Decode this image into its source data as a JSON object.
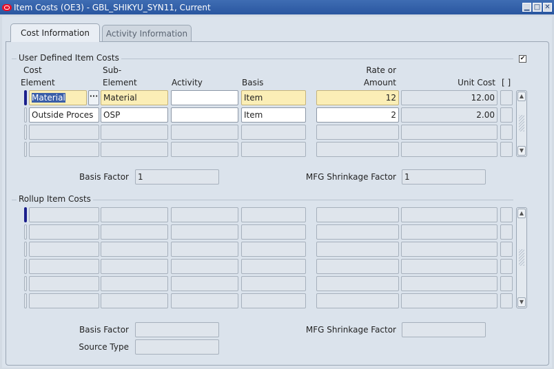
{
  "window": {
    "title": "Item Costs (OE3) - GBL_SHIKYU_SYN11, Current"
  },
  "tabs": [
    {
      "label": "Cost Information",
      "active": true
    },
    {
      "label": "Activity Information",
      "active": false
    }
  ],
  "user_defined": {
    "section_label": "User Defined Item Costs",
    "headers": {
      "cost_element_1": "Cost",
      "cost_element_2": "Element",
      "sub_element_1": "Sub-",
      "sub_element_2": "Element",
      "activity": "Activity",
      "basis": "Basis",
      "rate_1": "Rate or",
      "rate_2": "Amount",
      "unit_cost": "Unit Cost",
      "flag": "[ ]"
    },
    "rows": [
      {
        "cost_element": "Material",
        "sub_element": "Material",
        "activity": "",
        "basis": "Item",
        "rate": "12",
        "unit_cost": "12.00"
      },
      {
        "cost_element": "Outside Proces",
        "sub_element": "OSP",
        "activity": "",
        "basis": "Item",
        "rate": "2",
        "unit_cost": "2.00"
      }
    ],
    "basis_factor_label": "Basis Factor",
    "basis_factor_value": "1",
    "shrinkage_label": "MFG Shrinkage Factor",
    "shrinkage_value": "1"
  },
  "rollup": {
    "section_label": "Rollup Item Costs",
    "basis_factor_label": "Basis Factor",
    "basis_factor_value": "",
    "shrinkage_label": "MFG Shrinkage Factor",
    "shrinkage_value": "",
    "source_type_label": "Source Type",
    "source_type_value": ""
  },
  "colors": {
    "titlebar": "#2a56a0",
    "required": "#fbeeb6",
    "current_record": "#1b1f8c"
  }
}
